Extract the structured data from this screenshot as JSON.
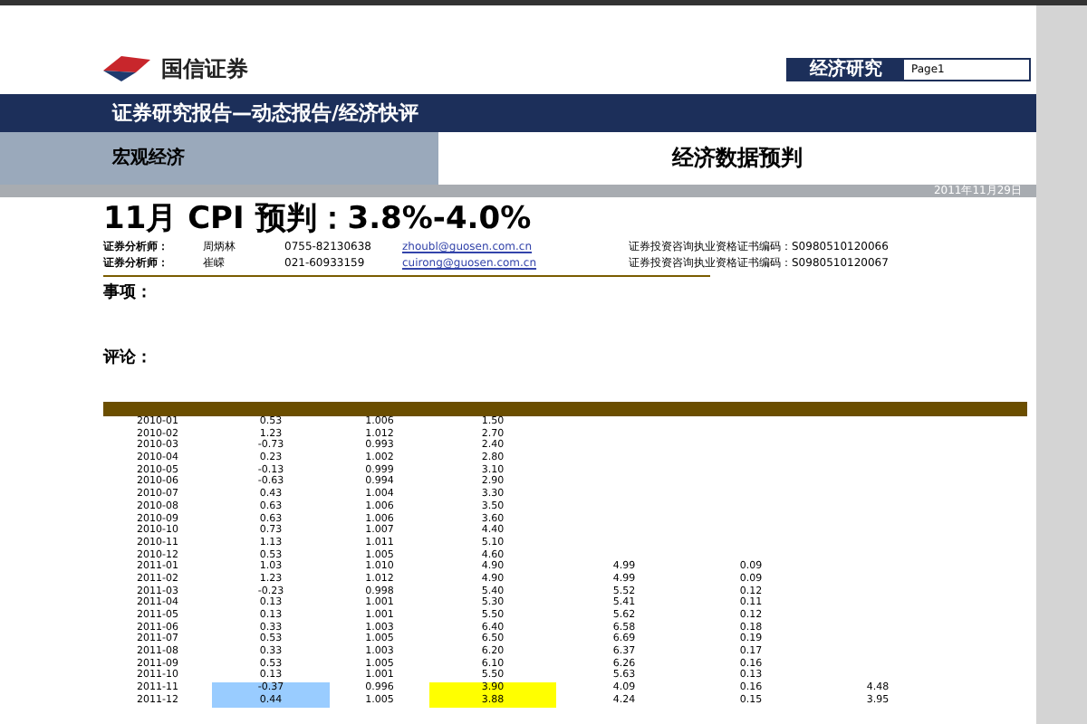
{
  "header": {
    "brand": "国信证券",
    "section_tag": "经济研究",
    "page": "Page1"
  },
  "title_bar": "证券研究报告—动态报告/经济快评",
  "category": "宏观经济",
  "report_type": "经济数据预判",
  "date": "2011年11月29日",
  "headline": "11月 CPI 预判：3.8%-4.0%",
  "analysts": [
    {
      "role": "证券分析师：",
      "name": "周炳林",
      "phone": "0755-82130638",
      "email": "zhoubl@guosen.com.cn",
      "license": "证券投资咨询执业资格证书编码：S0980510120066"
    },
    {
      "role": "证券分析师：",
      "name": "崔嵘",
      "phone": "021-60933159",
      "email": "cuirong@guosen.com.cn",
      "license": "证券投资咨询执业资格证书编码：S0980510120067"
    }
  ],
  "sections": [
    "事项：",
    "评论："
  ],
  "table": {
    "rows": [
      {
        "cells": [
          {
            "v": "2010-01"
          },
          {
            "v": "0.53"
          },
          {
            "v": "1.006"
          },
          {
            "v": "1.50"
          }
        ]
      },
      {
        "cells": [
          {
            "v": "2010-02"
          },
          {
            "v": "1.23"
          },
          {
            "v": "1.012"
          },
          {
            "v": "2.70"
          }
        ]
      },
      {
        "cells": [
          {
            "v": "2010-03"
          },
          {
            "v": "-0.73"
          },
          {
            "v": "0.993"
          },
          {
            "v": "2.40"
          }
        ]
      },
      {
        "cells": [
          {
            "v": "2010-04"
          },
          {
            "v": "0.23"
          },
          {
            "v": "1.002"
          },
          {
            "v": "2.80"
          }
        ]
      },
      {
        "cells": [
          {
            "v": "2010-05"
          },
          {
            "v": "-0.13"
          },
          {
            "v": "0.999"
          },
          {
            "v": "3.10"
          }
        ]
      },
      {
        "cells": [
          {
            "v": "2010-06"
          },
          {
            "v": "-0.63"
          },
          {
            "v": "0.994"
          },
          {
            "v": "2.90"
          }
        ]
      },
      {
        "cells": [
          {
            "v": "2010-07"
          },
          {
            "v": "0.43"
          },
          {
            "v": "1.004"
          },
          {
            "v": "3.30"
          }
        ]
      },
      {
        "cells": [
          {
            "v": "2010-08"
          },
          {
            "v": "0.63"
          },
          {
            "v": "1.006"
          },
          {
            "v": "3.50"
          }
        ]
      },
      {
        "cells": [
          {
            "v": "2010-09"
          },
          {
            "v": "0.63"
          },
          {
            "v": "1.006"
          },
          {
            "v": "3.60"
          }
        ]
      },
      {
        "cells": [
          {
            "v": "2010-10"
          },
          {
            "v": "0.73"
          },
          {
            "v": "1.007"
          },
          {
            "v": "4.40"
          }
        ]
      },
      {
        "cells": [
          {
            "v": "2010-11"
          },
          {
            "v": "1.13"
          },
          {
            "v": "1.011"
          },
          {
            "v": "5.10"
          }
        ]
      },
      {
        "cells": [
          {
            "v": "2010-12"
          },
          {
            "v": "0.53"
          },
          {
            "v": "1.005"
          },
          {
            "v": "4.60"
          }
        ]
      },
      {
        "cells": [
          {
            "v": "2011-01"
          },
          {
            "v": "1.03"
          },
          {
            "v": "1.010"
          },
          {
            "v": "4.90"
          },
          {
            "v": "4.99"
          },
          {
            "v": "0.09"
          }
        ]
      },
      {
        "cells": [
          {
            "v": "2011-02"
          },
          {
            "v": "1.23"
          },
          {
            "v": "1.012"
          },
          {
            "v": "4.90"
          },
          {
            "v": "4.99"
          },
          {
            "v": "0.09"
          }
        ]
      },
      {
        "cells": [
          {
            "v": "2011-03"
          },
          {
            "v": "-0.23"
          },
          {
            "v": "0.998"
          },
          {
            "v": "5.40"
          },
          {
            "v": "5.52"
          },
          {
            "v": "0.12"
          }
        ]
      },
      {
        "cells": [
          {
            "v": "2011-04"
          },
          {
            "v": "0.13"
          },
          {
            "v": "1.001"
          },
          {
            "v": "5.30"
          },
          {
            "v": "5.41"
          },
          {
            "v": "0.11"
          }
        ]
      },
      {
        "cells": [
          {
            "v": "2011-05"
          },
          {
            "v": "0.13"
          },
          {
            "v": "1.001"
          },
          {
            "v": "5.50"
          },
          {
            "v": "5.62"
          },
          {
            "v": "0.12"
          }
        ]
      },
      {
        "cells": [
          {
            "v": "2011-06"
          },
          {
            "v": "0.33"
          },
          {
            "v": "1.003"
          },
          {
            "v": "6.40"
          },
          {
            "v": "6.58"
          },
          {
            "v": "0.18"
          }
        ]
      },
      {
        "cells": [
          {
            "v": "2011-07"
          },
          {
            "v": "0.53"
          },
          {
            "v": "1.005"
          },
          {
            "v": "6.50"
          },
          {
            "v": "6.69"
          },
          {
            "v": "0.19"
          }
        ]
      },
      {
        "cells": [
          {
            "v": "2011-08"
          },
          {
            "v": "0.33"
          },
          {
            "v": "1.003"
          },
          {
            "v": "6.20"
          },
          {
            "v": "6.37"
          },
          {
            "v": "0.17"
          }
        ]
      },
      {
        "cells": [
          {
            "v": "2011-09"
          },
          {
            "v": "0.53"
          },
          {
            "v": "1.005"
          },
          {
            "v": "6.10"
          },
          {
            "v": "6.26"
          },
          {
            "v": "0.16"
          }
        ]
      },
      {
        "cells": [
          {
            "v": "2011-10"
          },
          {
            "v": "0.13"
          },
          {
            "v": "1.001"
          },
          {
            "v": "5.50"
          },
          {
            "v": "5.63"
          },
          {
            "v": "0.13"
          }
        ]
      },
      {
        "cells": [
          {
            "v": "2011-11"
          },
          {
            "v": "-0.37",
            "color": "#99ccff"
          },
          {
            "v": "0.996"
          },
          {
            "v": "3.90",
            "color": "#ffff00"
          },
          {
            "v": "4.09"
          },
          {
            "v": "0.16"
          },
          {
            "v": "4.48"
          }
        ]
      },
      {
        "cells": [
          {
            "v": "2011-12"
          },
          {
            "v": "0.44",
            "color": "#99ccff"
          },
          {
            "v": "1.005"
          },
          {
            "v": "3.88",
            "color": "#ffff00"
          },
          {
            "v": "4.24"
          },
          {
            "v": "0.15"
          },
          {
            "v": "3.95"
          }
        ]
      }
    ]
  }
}
